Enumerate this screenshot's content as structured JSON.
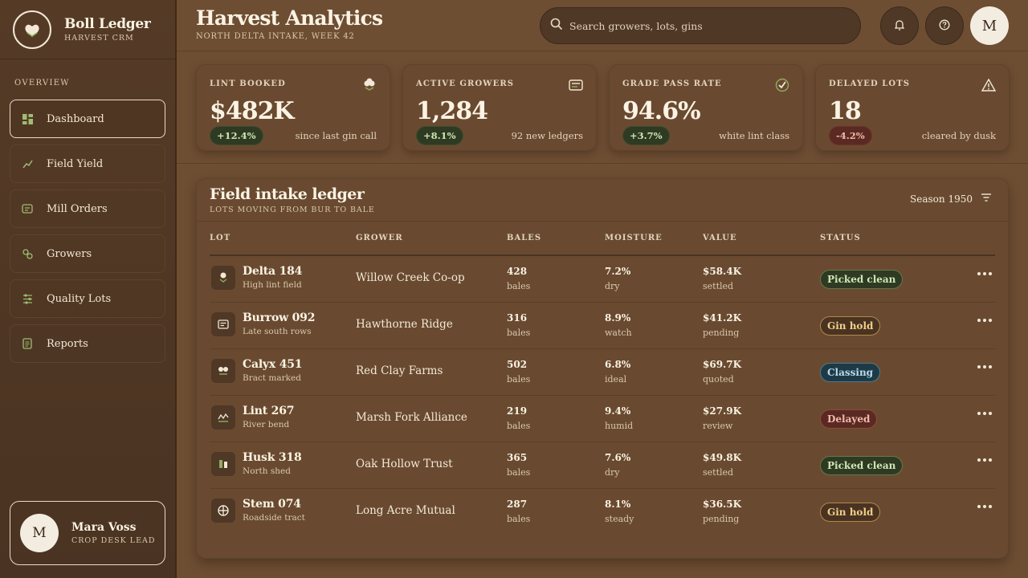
{
  "brand": {
    "name": "Boll Ledger",
    "subtitle": "HARVEST CRM"
  },
  "sidebar": {
    "section": "OVERVIEW",
    "items": [
      {
        "label": "Dashboard",
        "icon": "dashboard-icon",
        "active": true
      },
      {
        "label": "Field Yield",
        "icon": "trend-icon"
      },
      {
        "label": "Mill Orders",
        "icon": "orders-icon"
      },
      {
        "label": "Growers",
        "icon": "growers-icon"
      },
      {
        "label": "Quality Lots",
        "icon": "sliders-icon"
      },
      {
        "label": "Reports",
        "icon": "report-icon"
      }
    ],
    "user": {
      "initial": "M",
      "name": "Mara Voss",
      "role": "CROP DESK LEAD"
    }
  },
  "header": {
    "title": "Harvest Analytics",
    "subtitle": "NORTH DELTA INTAKE, WEEK 42",
    "search_placeholder": "Search growers, lots, gins",
    "avatar_initial": "M"
  },
  "stats": [
    {
      "label": "LINT BOOKED",
      "value": "$482K",
      "delta": "+12.4%",
      "trend": "up",
      "note": "since last gin call",
      "icon": "cotton-icon"
    },
    {
      "label": "ACTIVE GROWERS",
      "value": "1,284",
      "delta": "+8.1%",
      "trend": "up",
      "note": "92 new ledgers",
      "icon": "card-icon"
    },
    {
      "label": "GRADE PASS RATE",
      "value": "94.6%",
      "delta": "+3.7%",
      "trend": "up",
      "note": "white lint class",
      "icon": "check-icon"
    },
    {
      "label": "DELAYED LOTS",
      "value": "18",
      "delta": "-4.2%",
      "trend": "down",
      "note": "cleared by dusk",
      "icon": "warning-icon"
    }
  ],
  "ledger": {
    "title": "Field intake ledger",
    "subtitle": "LOTS MOVING FROM BUR TO BALE",
    "season": "Season 1950",
    "columns": [
      "LOT",
      "GROWER",
      "BALES",
      "MOISTURE",
      "VALUE",
      "STATUS"
    ],
    "rows": [
      {
        "lot": "Delta 184",
        "lot_sub": "High lint field",
        "grower": "Willow Creek Co-op",
        "bales": "428",
        "bales_sub": "bales",
        "moisture": "7.2%",
        "moisture_sub": "dry",
        "value": "$58.4K",
        "value_sub": "settled",
        "status": "Picked clean",
        "status_kind": "clean"
      },
      {
        "lot": "Burrow 092",
        "lot_sub": "Late south rows",
        "grower": "Hawthorne Ridge",
        "bales": "316",
        "bales_sub": "bales",
        "moisture": "8.9%",
        "moisture_sub": "watch",
        "value": "$41.2K",
        "value_sub": "pending",
        "status": "Gin hold",
        "status_kind": "hold"
      },
      {
        "lot": "Calyx 451",
        "lot_sub": "Bract marked",
        "grower": "Red Clay Farms",
        "bales": "502",
        "bales_sub": "bales",
        "moisture": "6.8%",
        "moisture_sub": "ideal",
        "value": "$69.7K",
        "value_sub": "quoted",
        "status": "Classing",
        "status_kind": "class"
      },
      {
        "lot": "Lint 267",
        "lot_sub": "River bend",
        "grower": "Marsh Fork Alliance",
        "bales": "219",
        "bales_sub": "bales",
        "moisture": "9.4%",
        "moisture_sub": "humid",
        "value": "$27.9K",
        "value_sub": "review",
        "status": "Delayed",
        "status_kind": "delay"
      },
      {
        "lot": "Husk 318",
        "lot_sub": "North shed",
        "grower": "Oak Hollow Trust",
        "bales": "365",
        "bales_sub": "bales",
        "moisture": "7.6%",
        "moisture_sub": "dry",
        "value": "$49.8K",
        "value_sub": "settled",
        "status": "Picked clean",
        "status_kind": "clean"
      },
      {
        "lot": "Stem 074",
        "lot_sub": "Roadside tract",
        "grower": "Long Acre Mutual",
        "bales": "287",
        "bales_sub": "bales",
        "moisture": "8.1%",
        "moisture_sub": "steady",
        "value": "$36.5K",
        "value_sub": "pending",
        "status": "Gin hold",
        "status_kind": "hold"
      }
    ]
  },
  "colors": {
    "accent_green": "#8fae5e",
    "background": "#6e4e33",
    "sidebar": "#4f3623"
  }
}
